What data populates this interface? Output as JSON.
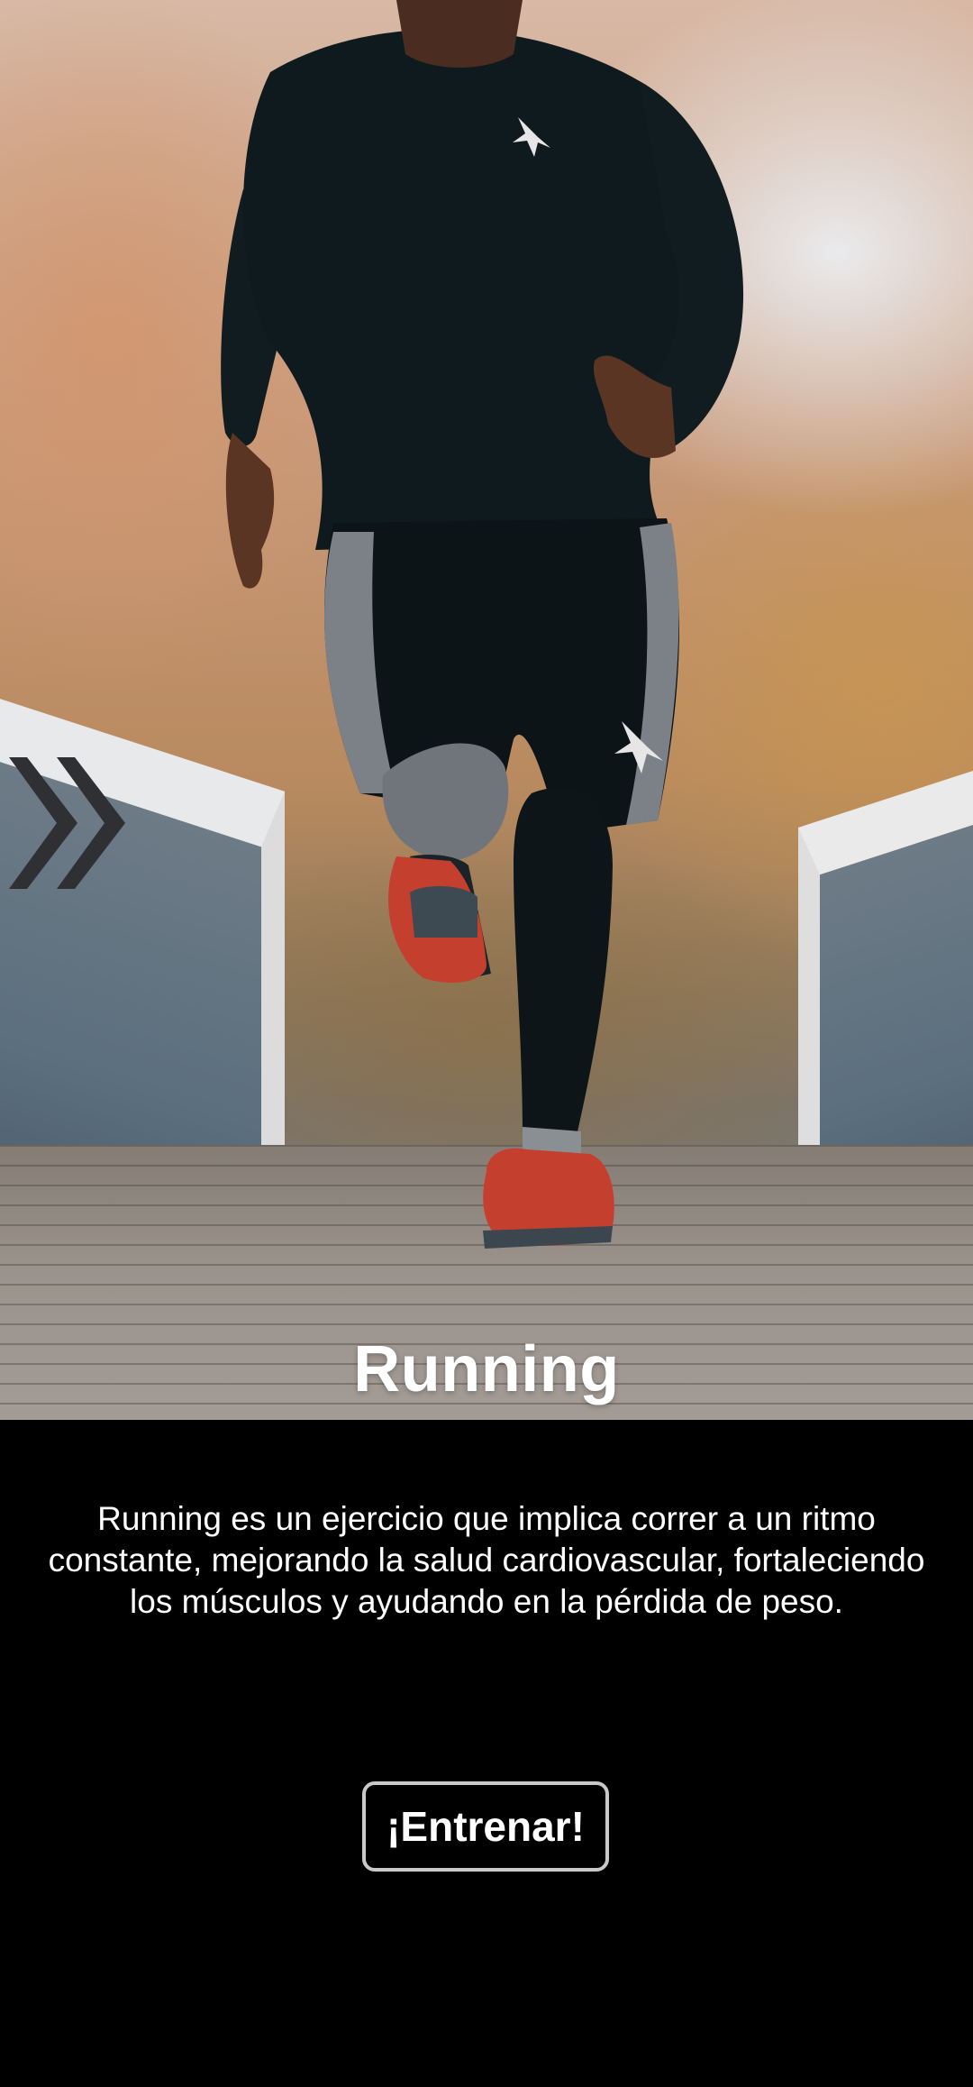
{
  "hero": {
    "title": "Running",
    "image": "runner-on-bridge"
  },
  "navigation": {
    "next_icon": "double-chevron-right-icon"
  },
  "description": {
    "text": "Running es un ejercicio que implica correr a un ritmo constante, mejorando la salud cardiovascular, fortaleciendo los músculos y ayudando en la pérdida de peso."
  },
  "actions": {
    "train_label": "¡Entrenar!"
  },
  "colors": {
    "background": "#000000",
    "text": "#ffffff",
    "button_border": "#c9c9c9",
    "chevron": "#2e3033"
  }
}
